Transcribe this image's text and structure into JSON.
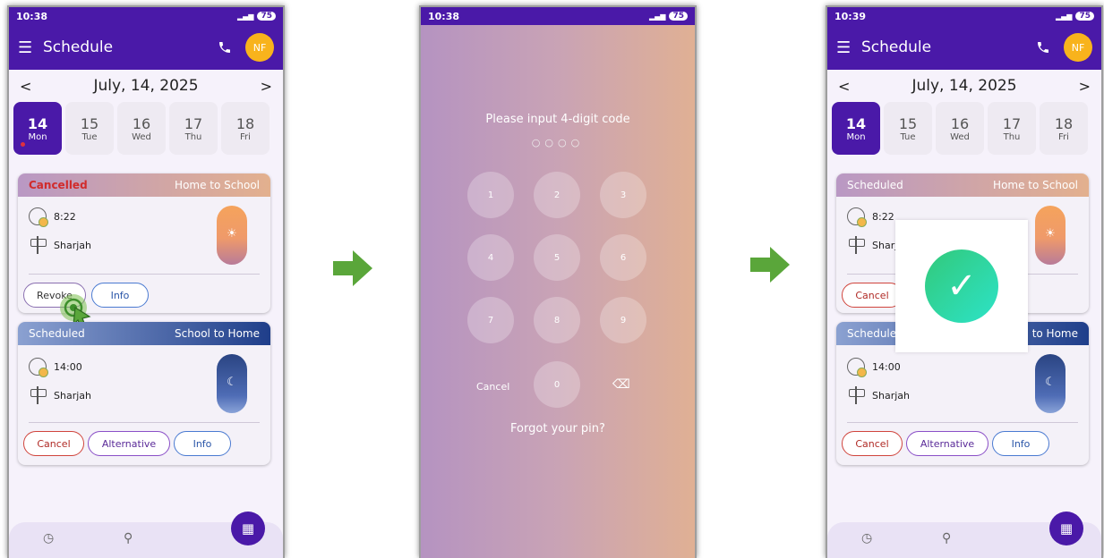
{
  "screen1": {
    "status_time": "10:38",
    "battery": "75",
    "app_title": "Schedule",
    "avatar_initials": "NF",
    "date": "July, 14, 2025",
    "prev": "<",
    "next": ">",
    "days": [
      {
        "num": "14",
        "wd": "Mon"
      },
      {
        "num": "15",
        "wd": "Tue"
      },
      {
        "num": "16",
        "wd": "Wed"
      },
      {
        "num": "17",
        "wd": "Thu"
      },
      {
        "num": "18",
        "wd": "Fri"
      }
    ],
    "trip1": {
      "status": "Cancelled",
      "route": "Home to School",
      "time": "8:22",
      "place": "Sharjah",
      "btn1": "Revoke",
      "btn2": "Info"
    },
    "trip2": {
      "status": "Scheduled",
      "route": "School to Home",
      "time": "14:00",
      "place": "Sharjah",
      "btn1": "Cancel",
      "btn2": "Alternative",
      "btn3": "Info"
    }
  },
  "screen2": {
    "status_time": "10:38",
    "battery": "75",
    "prompt": "Please input 4-digit code",
    "pin_dots": "○○○○",
    "keys": [
      "1",
      "2",
      "3",
      "4",
      "5",
      "6",
      "7",
      "8",
      "9",
      "0"
    ],
    "cancel": "Cancel",
    "forgot": "Forgot your pin?"
  },
  "screen3": {
    "status_time": "10:39",
    "battery": "75",
    "app_title": "Schedule",
    "avatar_initials": "NF",
    "date": "July, 14, 2025",
    "prev": "<",
    "next": ">",
    "days": [
      {
        "num": "14",
        "wd": "Mon"
      },
      {
        "num": "15",
        "wd": "Tue"
      },
      {
        "num": "16",
        "wd": "Wed"
      },
      {
        "num": "17",
        "wd": "Thu"
      },
      {
        "num": "18",
        "wd": "Fri"
      }
    ],
    "trip1": {
      "status": "Scheduled",
      "route": "Home to School",
      "time": "8:22",
      "place": "Sharj",
      "btn1": "Cancel"
    },
    "trip2": {
      "status": "Scheduled",
      "route": "l to Home",
      "time": "14:00",
      "place": "Sharjah",
      "btn1": "Cancel",
      "btn2": "Alternative",
      "btn3": "Info"
    }
  },
  "colors": {
    "primary": "#4a19a8",
    "avatar": "#f8b31c",
    "arrow": "#5aa63a",
    "success": "#2ed39a"
  },
  "icons": [
    "menu-icon",
    "phone-icon",
    "clock-icon",
    "signpost-icon",
    "history-icon",
    "location-icon",
    "calendar-icon",
    "backspace-icon",
    "checkmark-icon",
    "cursor-icon"
  ]
}
